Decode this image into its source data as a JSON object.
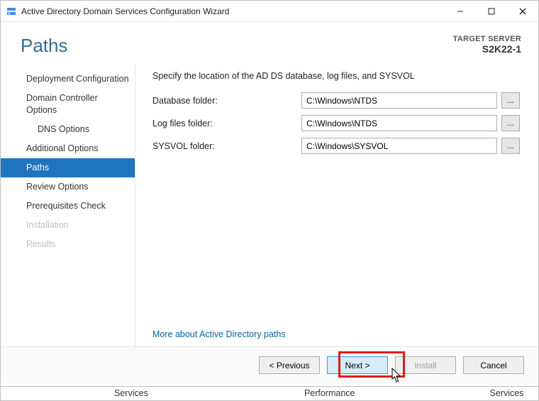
{
  "window_title": "Active Directory Domain Services Configuration Wizard",
  "page_title": "Paths",
  "target": {
    "label": "TARGET SERVER",
    "name": "S2K22-1"
  },
  "sidebar": [
    {
      "label": "Deployment Configuration",
      "indent": false,
      "disabled": false
    },
    {
      "label": "Domain Controller Options",
      "indent": false,
      "disabled": false
    },
    {
      "label": "DNS Options",
      "indent": true,
      "disabled": false
    },
    {
      "label": "Additional Options",
      "indent": false,
      "disabled": false
    },
    {
      "label": "Paths",
      "indent": false,
      "disabled": false,
      "active": true
    },
    {
      "label": "Review Options",
      "indent": false,
      "disabled": false
    },
    {
      "label": "Prerequisites Check",
      "indent": false,
      "disabled": false
    },
    {
      "label": "Installation",
      "indent": false,
      "disabled": true
    },
    {
      "label": "Results",
      "indent": false,
      "disabled": true
    }
  ],
  "intro_text": "Specify the location of the AD DS database, log files, and SYSVOL",
  "fields": {
    "db": {
      "label": "Database folder:",
      "value": "C:\\Windows\\NTDS"
    },
    "log": {
      "label": "Log files folder:",
      "value": "C:\\Windows\\NTDS"
    },
    "sysvol": {
      "label": "SYSVOL folder:",
      "value": "C:\\Windows\\SYSVOL"
    }
  },
  "browse_label": "...",
  "more_link": "More about Active Directory paths",
  "buttons": {
    "prev": "< Previous",
    "next": "Next >",
    "install": "Install",
    "cancel": "Cancel"
  },
  "background_labels": {
    "services": "Services",
    "performance": "Performance",
    "services2": "Services"
  }
}
